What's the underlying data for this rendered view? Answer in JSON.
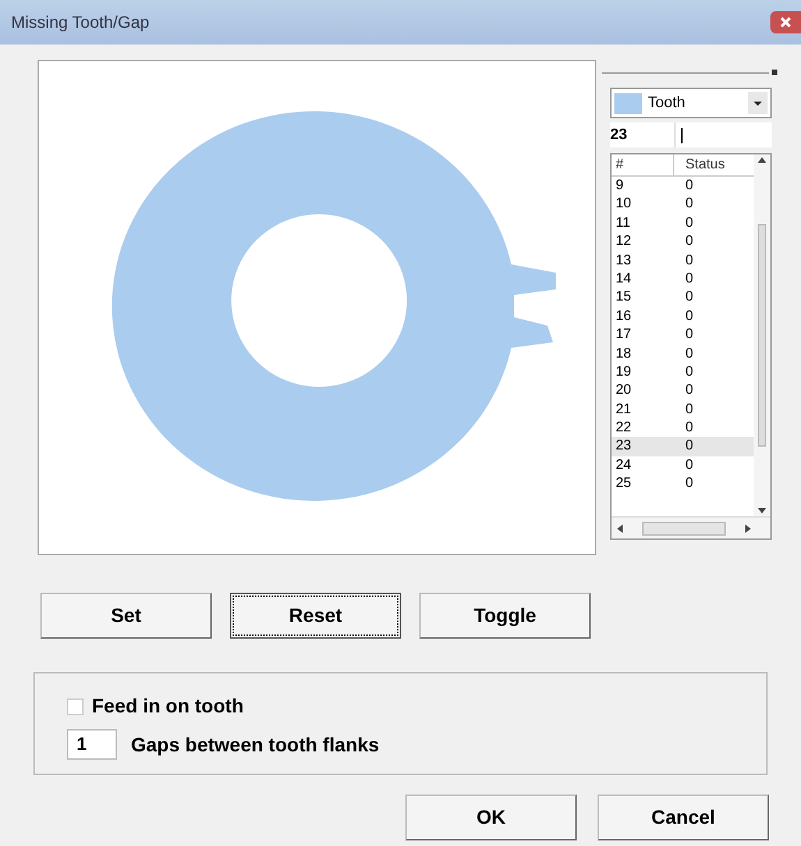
{
  "window": {
    "title": "Missing Tooth/Gap"
  },
  "panel": {
    "combo": {
      "value": "Tooth",
      "color": "#aaccee"
    },
    "index": "23",
    "list": {
      "columns": [
        "#",
        "Status"
      ],
      "rows": [
        {
          "n": "9",
          "status": "0",
          "selected": false
        },
        {
          "n": "10",
          "status": "0",
          "selected": false
        },
        {
          "n": "11",
          "status": "0",
          "selected": false
        },
        {
          "n": "12",
          "status": "0",
          "selected": false
        },
        {
          "n": "13",
          "status": "0",
          "selected": false
        },
        {
          "n": "14",
          "status": "0",
          "selected": false
        },
        {
          "n": "15",
          "status": "0",
          "selected": false
        },
        {
          "n": "16",
          "status": "0",
          "selected": false
        },
        {
          "n": "17",
          "status": "0",
          "selected": false
        },
        {
          "n": "18",
          "status": "0",
          "selected": false
        },
        {
          "n": "19",
          "status": "0",
          "selected": false
        },
        {
          "n": "20",
          "status": "0",
          "selected": false
        },
        {
          "n": "21",
          "status": "0",
          "selected": false
        },
        {
          "n": "22",
          "status": "0",
          "selected": false
        },
        {
          "n": "23",
          "status": "0",
          "selected": true
        },
        {
          "n": "24",
          "status": "0",
          "selected": false
        },
        {
          "n": "25",
          "status": "0",
          "selected": false
        }
      ]
    }
  },
  "actions": [
    {
      "label": "Set",
      "focused": false
    },
    {
      "label": "Reset",
      "focused": true
    },
    {
      "label": "Toggle",
      "focused": false
    }
  ],
  "options": {
    "feed": {
      "label": "Feed in on tooth",
      "checked": false
    },
    "gaps": {
      "value": "1",
      "label": "Gaps between tooth flanks"
    }
  },
  "buttons": [
    "OK",
    "Cancel"
  ]
}
